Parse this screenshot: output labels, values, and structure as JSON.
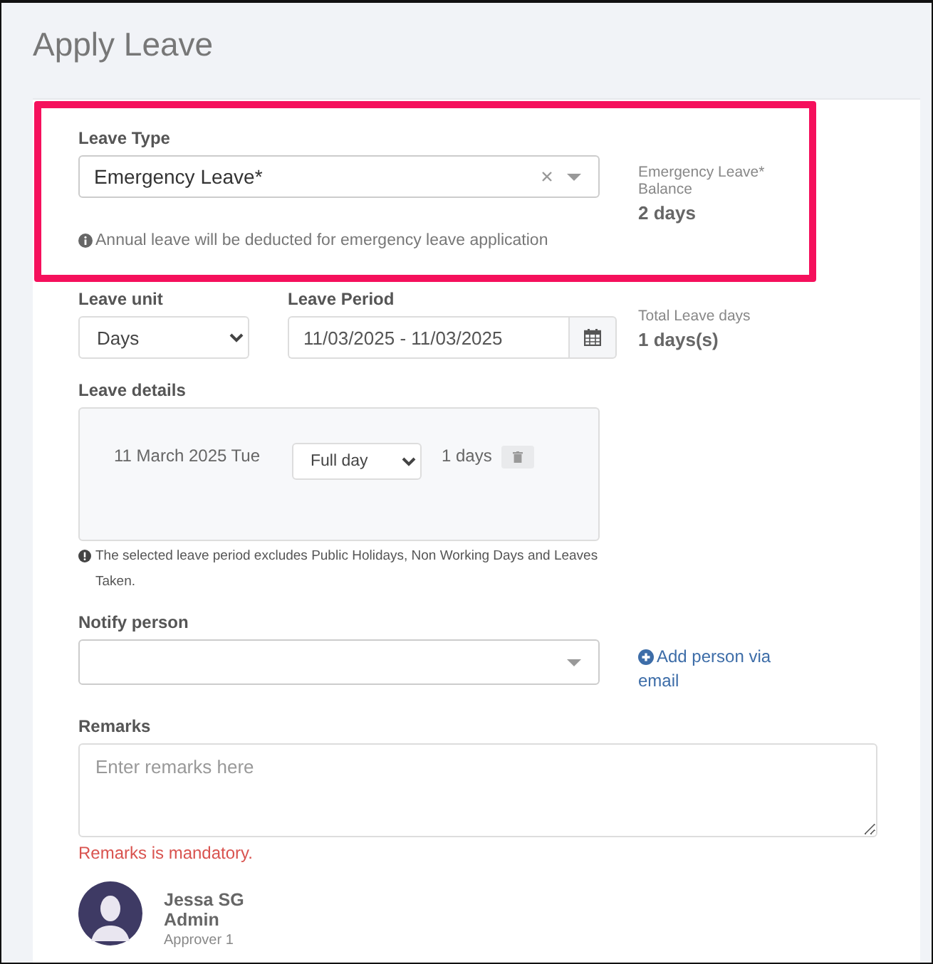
{
  "page": {
    "title": "Apply Leave"
  },
  "leave_type": {
    "label": "Leave Type",
    "value": "Emergency Leave*",
    "highlighted": true,
    "note": "Annual leave will be deducted for emergency leave application"
  },
  "balance": {
    "label": "Emergency Leave* Balance",
    "value": "2 days"
  },
  "leave_unit": {
    "label": "Leave unit",
    "value": "Days"
  },
  "leave_period": {
    "label": "Leave Period",
    "value": "11/03/2025 - 11/03/2025"
  },
  "total": {
    "label": "Total Leave days",
    "value": "1 days(s)"
  },
  "leave_details": {
    "label": "Leave details",
    "rows": [
      {
        "date": "11 March 2025 Tue",
        "duration": "Full day",
        "days": "1 days"
      }
    ],
    "note": "The selected leave period excludes Public Holidays, Non Working Days and Leaves Taken."
  },
  "notify": {
    "label": "Notify person",
    "link": "Add person via email"
  },
  "remarks": {
    "label": "Remarks",
    "placeholder": "Enter remarks here",
    "error": "Remarks is mandatory."
  },
  "approvers": [
    {
      "name": "Jessa SG Admin",
      "step": "Approver 1"
    }
  ]
}
